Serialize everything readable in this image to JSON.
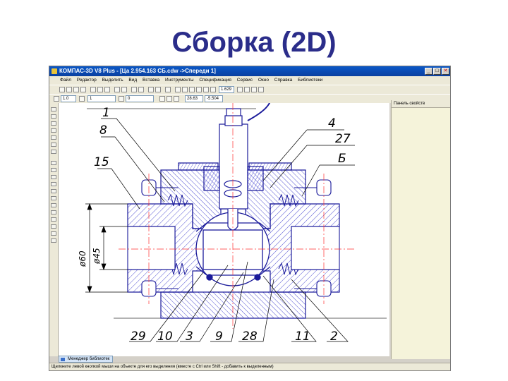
{
  "slide": {
    "title": "Сборка (2D)"
  },
  "window": {
    "title": "КОМПАС-3D V8 Plus - [Ца 2.954.163 СБ.cdw ->Спереди 1]",
    "controls": {
      "minimize": "_",
      "maximize": "□",
      "close": "✕"
    }
  },
  "menu": {
    "items": [
      "Файл",
      "Редактор",
      "Выделить",
      "Вид",
      "Вставка",
      "Инструменты",
      "Спецификация",
      "Сервис",
      "Окно",
      "Справка",
      "Библиотеки"
    ]
  },
  "toolbar": {
    "zoom": "1.629",
    "line_scale": "1.0",
    "step": "1",
    "angle": "0",
    "coord_x": "28.63",
    "coord_y": "-5.504"
  },
  "properties_panel": {
    "title": "Панель свойств"
  },
  "bottom_tab": {
    "label": "Менеджер библиотек"
  },
  "status": {
    "text": "Щелкните левой кнопкой мыши на объекте для его выделения (вместе с Ctrl или Shift - добавить к выделенным)"
  },
  "drawing": {
    "callouts": [
      "1",
      "8",
      "15",
      "4",
      "27",
      "Б",
      "29",
      "10",
      "3",
      "9",
      "28",
      "11",
      "2"
    ],
    "dimensions": [
      "ø60",
      "ø45"
    ]
  }
}
